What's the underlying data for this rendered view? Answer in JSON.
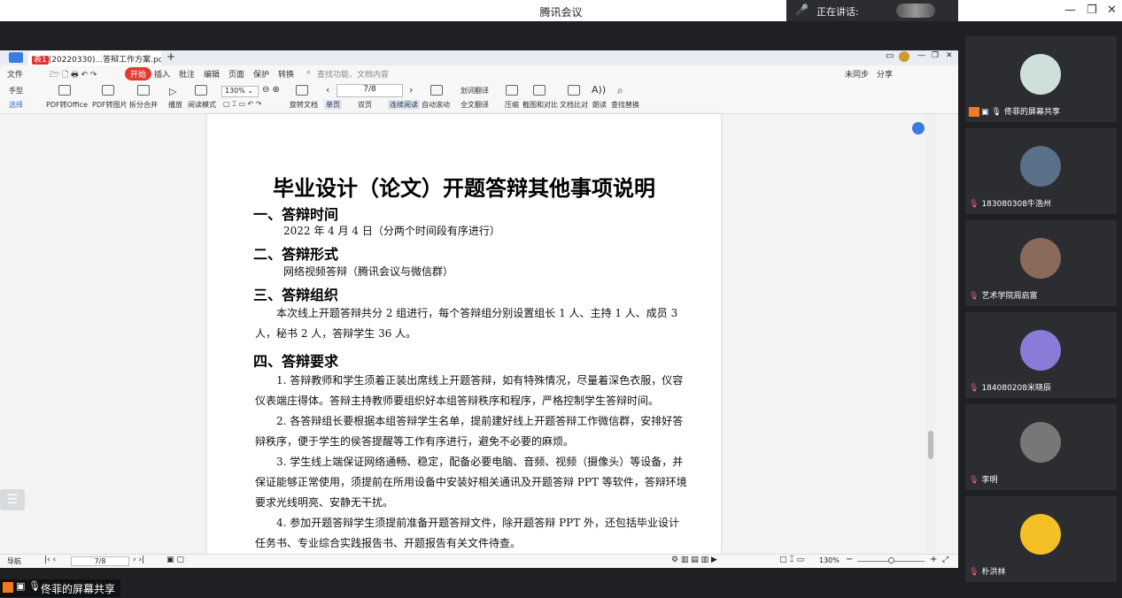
{
  "meeting": {
    "title": "腾讯会议",
    "speaking_label": "正在讲话:",
    "share_label": "佟菲的屏幕共享"
  },
  "wps": {
    "tab_badge": "表1",
    "tab_title": "(20220330)...答辩工作方案.pdf",
    "menu": [
      "文件",
      "开始",
      "插入",
      "批注",
      "编辑",
      "页面",
      "保护",
      "转换"
    ],
    "search_placeholder": "查找功能、文档内容",
    "sync": "未同步",
    "share": "分享",
    "ribbon": {
      "hand_tool": "手型",
      "select_tool": "选择",
      "pdf_to_office": "PDF转Office",
      "pdf_to_image": "PDF转图片",
      "split_merge": "拆分合并",
      "play": "播放",
      "read_mode": "阅读模式",
      "zoom": "130%",
      "rotate": "旋转文档",
      "page_value": "7/8",
      "single_page": "单页",
      "double_page": "双页",
      "continuous": "连续阅读",
      "auto_scroll": "自动滚动",
      "translate_word": "划词翻译",
      "translate_full": "全文翻译",
      "compress": "压缩",
      "screenshot": "截图和对比",
      "compare": "文档比对",
      "read_aloud": "朗读",
      "find_replace": "查找替换"
    },
    "status": {
      "nav": "导航",
      "page": "7/8",
      "zoom": "130%"
    }
  },
  "document": {
    "title": "毕业设计（论文）开题答辩其他事项说明",
    "sections": [
      {
        "heading": "一、答辩时间",
        "body": [
          "2022 年 4 月 4 日（分两个时间段有序进行）"
        ]
      },
      {
        "heading": "二、答辩形式",
        "body": [
          "网络视频答辩（腾讯会议与微信群）"
        ]
      },
      {
        "heading": "三、答辩组织",
        "body": [
          "本次线上开题答辩共分 2 组进行，每个答辩组分别设置组长 1 人、主持 1 人、成员 3 人，秘书 2 人，答辩学生 36 人。"
        ]
      },
      {
        "heading": "四、答辩要求",
        "body": [
          "1. 答辩教师和学生须着正装出席线上开题答辩，如有特殊情况，尽量着深色衣服，仪容仪表端庄得体。答辩主持教师要组织好本组答辩秩序和程序，严格控制学生答辩时间。",
          "2. 各答辩组长要根据本组答辩学生名单，提前建好线上开题答辩工作微信群，安排好答辩秩序，便于学生的侯答提醒等工作有序进行，避免不必要的麻烦。",
          "3. 学生线上端保证网络通畅、稳定，配备必要电脑、音频、视频（摄像头）等设备，并保证能够正常使用，须提前在所用设备中安装好相关通讯及开题答辩 PPT 等软件，答辩环境要求光线明亮、安静无干扰。",
          "4. 参加开题答辩学生须提前准备开题答辩文件，除开题答辩 PPT 外，还包括毕业设计任务书、专业综合实践报告书、开题报告有关文件待查。"
        ]
      }
    ]
  },
  "participants": [
    {
      "name": "佟菲的屏幕共享",
      "host": true,
      "avatar_color": "#cfe0dc"
    },
    {
      "name": "183080308牛浩州",
      "host": false,
      "avatar_color": "#5a6f88"
    },
    {
      "name": "艺术学院周启富",
      "host": false,
      "avatar_color": "#8a6a5a"
    },
    {
      "name": "184080208米晓辰",
      "host": false,
      "avatar_color": "#8b7bd8"
    },
    {
      "name": "李明",
      "host": false,
      "avatar_color": "#777"
    },
    {
      "name": "朴洪林",
      "host": false,
      "avatar_color": "#f5c025"
    }
  ]
}
